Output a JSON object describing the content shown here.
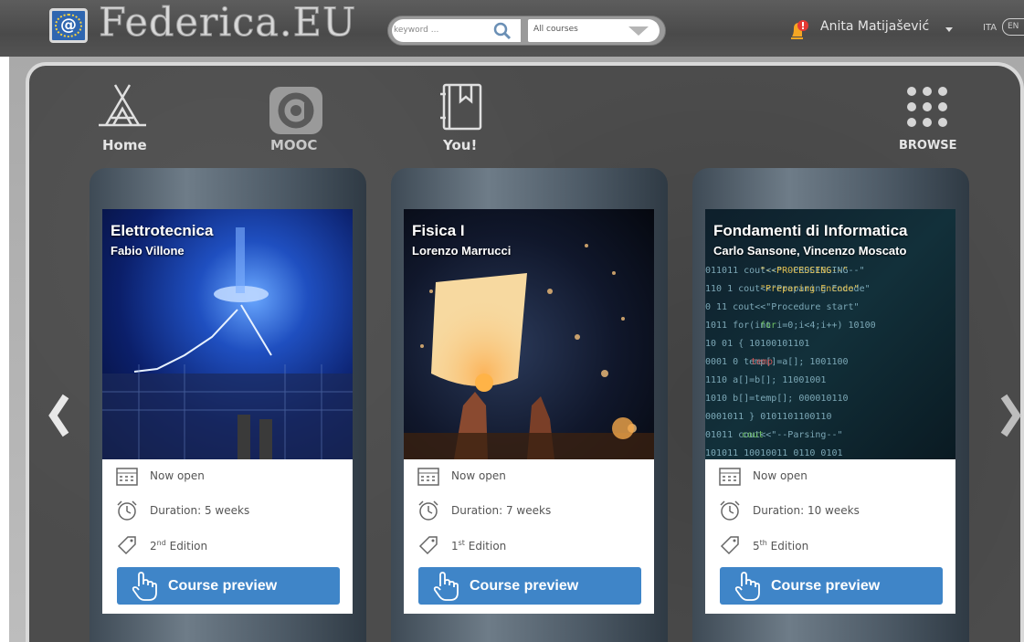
{
  "header": {
    "brand": "Federica.EU",
    "search_placeholder": "keyword ...",
    "filter_selected": "All courses",
    "user_name": "Anita Matijašević",
    "lang_it": "ITA",
    "lang_en": "EN",
    "icons": [
      "logo-icon",
      "search-icon",
      "chevron-down-icon",
      "bell-icon"
    ]
  },
  "nav": {
    "home": "Home",
    "mooc": "MOOC",
    "you": "You!",
    "browse": "BROWSE"
  },
  "courses": [
    {
      "title": "Elettrotecnica",
      "author": "Fabio Villone",
      "status": "Now open",
      "duration": "Duration: 5 weeks",
      "edition_num": "2",
      "edition_sup": "nd",
      "edition_word": " Edition",
      "button": "Course preview"
    },
    {
      "title": "Fisica I",
      "author": "Lorenzo Marrucci",
      "status": "Now open",
      "duration": "Duration: 7 weeks",
      "edition_num": "1",
      "edition_sup": "st",
      "edition_word": " Edition",
      "button": "Course preview"
    },
    {
      "title": "Fondamenti di Informatica",
      "author": "Carlo Sansone, Vincenzo Moscato",
      "status": "Now open",
      "duration": "Duration: 10 weeks",
      "edition_num": "5",
      "edition_sup": "th",
      "edition_word": " Edition",
      "button": "Course preview"
    }
  ],
  "colors": {
    "accent": "#3f85c8",
    "notification": "#e53935",
    "board": "#4c4c4c"
  }
}
